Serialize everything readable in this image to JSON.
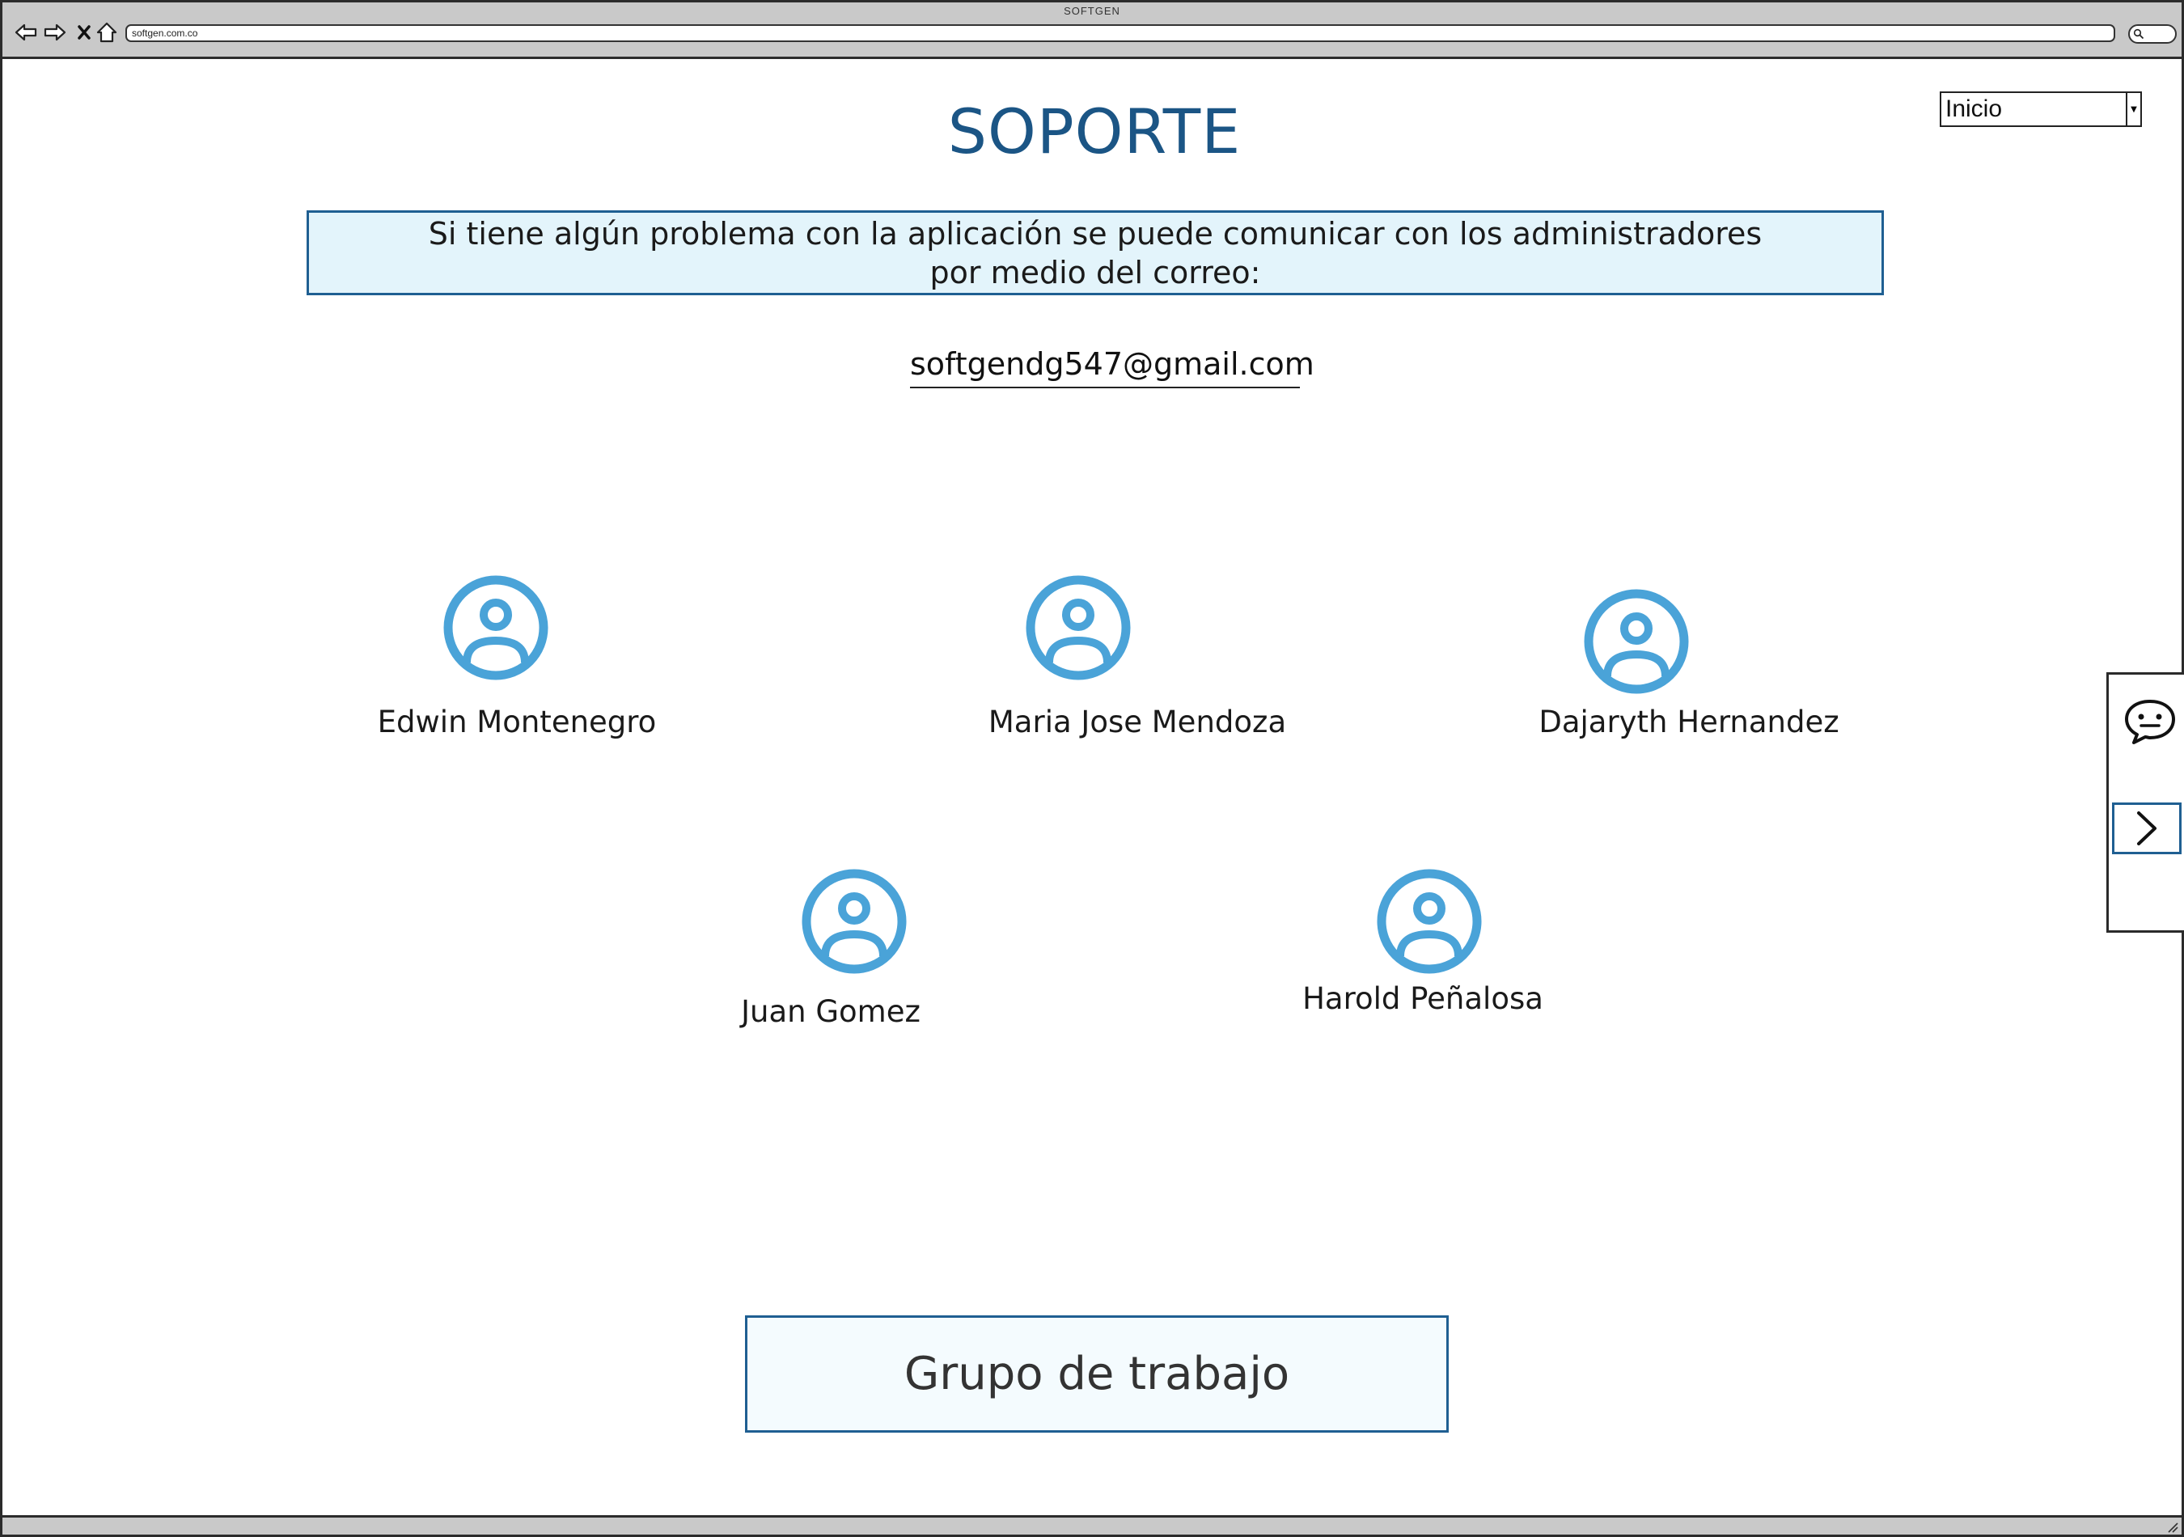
{
  "window": {
    "title": "SOFTGEN",
    "url": "softgen.com.co"
  },
  "page": {
    "title": "SOPORTE",
    "nav_select_value": "Inicio",
    "info_line1": "Si tiene algún problema con la aplicación se puede comunicar con los administradores",
    "info_line2": "por medio del correo:",
    "email": "softgendg547@gmail.com",
    "team_button_label": "Grupo de trabajo"
  },
  "members": [
    {
      "name": "Edwin Montenegro",
      "icon": "user-circle-icon"
    },
    {
      "name": "Maria Jose Mendoza",
      "icon": "user-circle-icon"
    },
    {
      "name": "Dajaryth Hernandez",
      "icon": "user-circle-icon"
    },
    {
      "name": "Juan Gomez",
      "icon": "user-circle-icon"
    },
    {
      "name": "Harold Peñalosa",
      "icon": "user-circle-icon"
    }
  ],
  "side_panel": {
    "chat_icon": "chat-bubble-icon",
    "next_icon": "chevron-right-icon"
  },
  "colors": {
    "accent": "#1b5585",
    "avatar": "#4aa3d8",
    "info_background": "#e3f4fb",
    "chrome": "#c9c9c9"
  }
}
